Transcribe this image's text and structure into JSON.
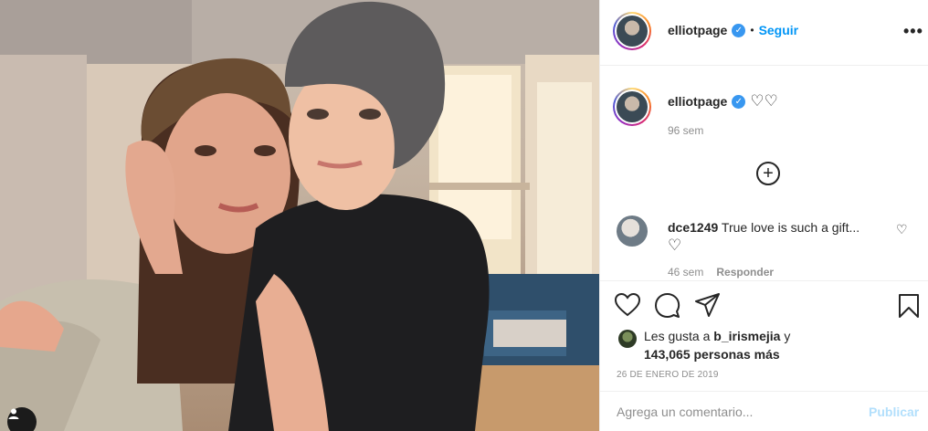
{
  "post": {
    "username": "elliotpage",
    "follow_label": "Seguir",
    "separator": "•",
    "more_options": "•••",
    "caption_hearts": "♡♡",
    "age": "96 sem",
    "load_more": "+"
  },
  "comments": [
    {
      "username": "dce1249",
      "text": "True love is such a gift...",
      "emoji": "♡",
      "age": "46 sem",
      "reply_label": "Responder",
      "like_icon": "♡"
    }
  ],
  "likes": {
    "prefix": "Les gusta a",
    "user": "b_irismejia",
    "connector": "y",
    "count_text": "143,065 personas más"
  },
  "date": "26 DE ENERO DE 2019",
  "composer": {
    "placeholder": "Agrega un comentario...",
    "publish_label": "Publicar"
  },
  "icons": {
    "verified": "verified-badge-icon",
    "like": "heart-icon",
    "comment": "comment-icon",
    "share": "share-icon",
    "save": "bookmark-icon",
    "tag": "user-tag-icon"
  },
  "colors": {
    "accent": "#0095f6",
    "verified": "#3897f0",
    "publish_disabled": "#b2dffc",
    "secondary_text": "#8e8e8e",
    "border": "#efefef"
  }
}
